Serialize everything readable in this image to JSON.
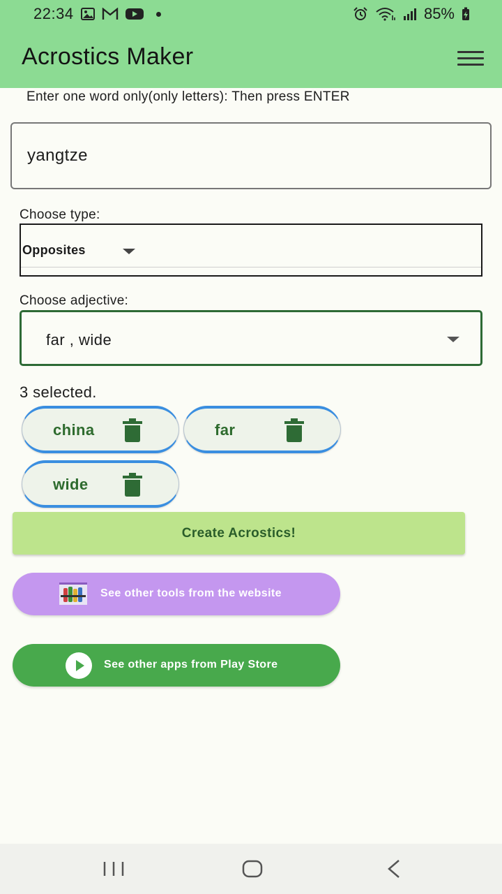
{
  "status_bar": {
    "time": "22:34",
    "battery": "85%",
    "icons": [
      "gallery-icon",
      "gmail-icon",
      "youtube-icon",
      "notification-dot-icon",
      "alarm-icon",
      "wifi-icon",
      "signal-icon",
      "battery-charging-icon"
    ]
  },
  "app_bar": {
    "title": "Acrostics Maker",
    "menu_icon": "hamburger-menu-icon"
  },
  "form": {
    "instruction": "Enter one word only(only letters): Then press ENTER",
    "word_value": "yangtze",
    "type_label": "Choose type:",
    "type_value": "Opposites",
    "adjective_label": "Choose adjective:",
    "adjective_value": "far , wide",
    "selected_count": "3 selected."
  },
  "chips": [
    {
      "label": "china"
    },
    {
      "label": "far"
    },
    {
      "label": "wide"
    }
  ],
  "actions": {
    "create_label": "Create Acrostics!",
    "tools_label": "See other tools from the website",
    "apps_label": "See other apps from Play Store"
  },
  "colors": {
    "app_bar": "#8cdb93",
    "chip_border": "#3a8ee0",
    "chip_text": "#2e6b2e",
    "create_button": "#bde48c",
    "tools_button": "#c497ef",
    "apps_button": "#48a94c",
    "adjective_border": "#2d6a35"
  }
}
